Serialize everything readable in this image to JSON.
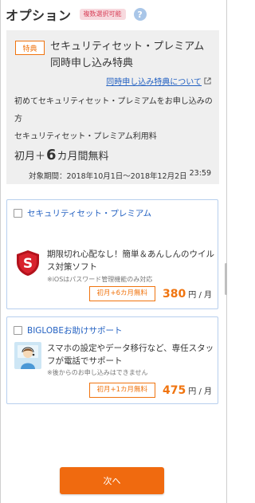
{
  "header": {
    "title": "オプション",
    "badge": "複数選択可能",
    "help_icon": "help-circle-icon",
    "help_glyph": "?"
  },
  "promo": {
    "badge": "特典",
    "title": "セキュリティセット・プレミアム同時申し込み特典",
    "link": "同時申し込み特典について",
    "desc_line1": "初めてセキュリティセット・プレミアムをお申し込みの方",
    "desc_line2": "セキュリティセット・プレミアム利用料",
    "free_prefix": "初月＋",
    "free_number": "6",
    "free_suffix": "カ月間無料",
    "period": "対象期間：2018年10月1日〜2018年12月2日",
    "period_time": "23:59"
  },
  "options": [
    {
      "title": "セキュリティセット・プレミアム",
      "icon": "security-shield-icon",
      "description": "期限切れ心配なし！簡単＆あんしんのウイルス対策ソフト",
      "note": "※iOSはパスワード管理機能のみ対応",
      "campaign": "初月+6カ月無料",
      "price": "380",
      "unit": "円 / 月"
    },
    {
      "title": "BIGLOBEお助けサポート",
      "icon": "support-operator-icon",
      "description": "スマホの設定やデータ移行など、専任スタッフが電話でサポート",
      "note": "※後からのお申し込みはできません",
      "campaign": "初月+1カ月無料",
      "price": "475",
      "unit": "円 / 月"
    }
  ],
  "next_button": "次へ",
  "colors": {
    "accent_orange": "#f06a0f",
    "link_blue": "#2361c2",
    "card_border": "#b7cfee",
    "panel_gray": "#efefef"
  }
}
